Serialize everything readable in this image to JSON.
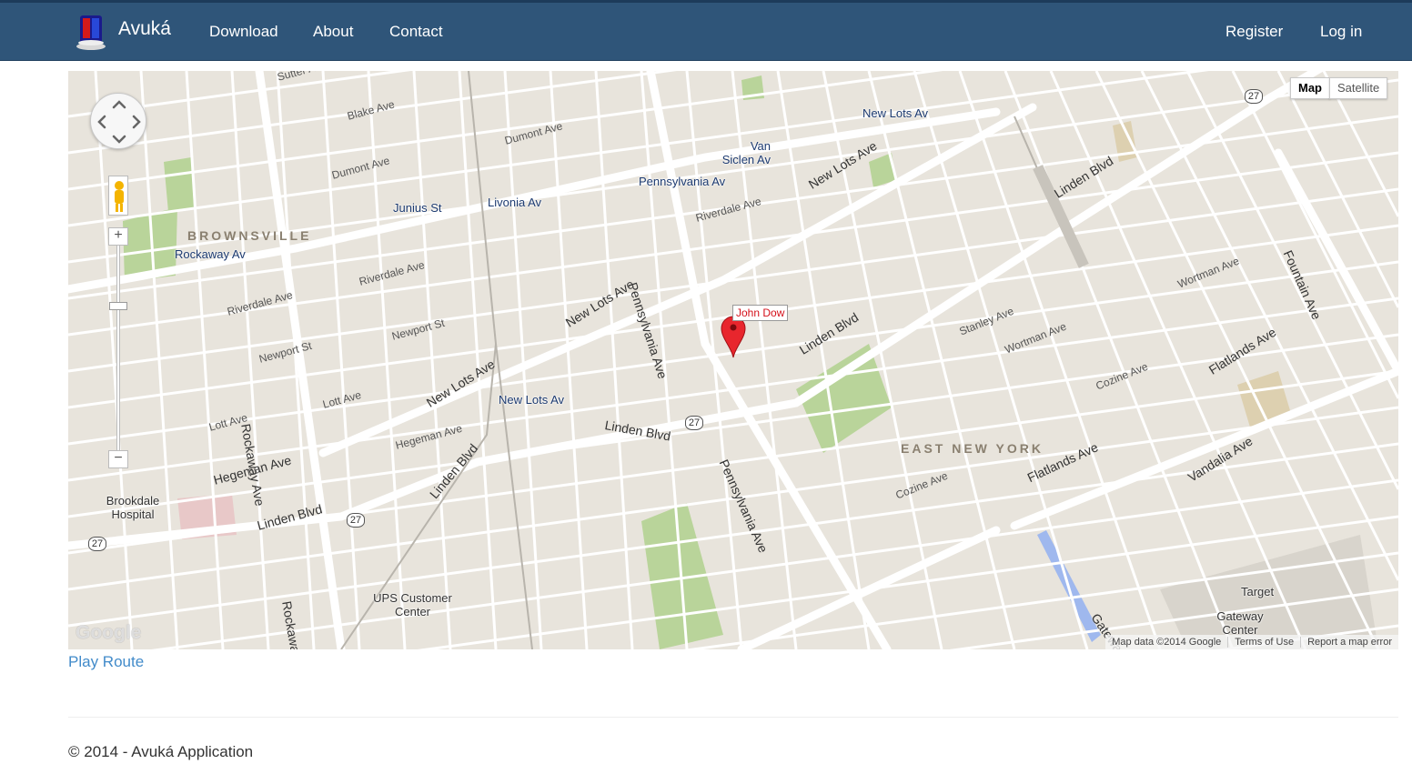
{
  "navbar": {
    "brand": "Avuká",
    "links": [
      "Download",
      "About",
      "Contact"
    ],
    "right_links": [
      "Register",
      "Log in"
    ]
  },
  "map": {
    "type_buttons": [
      "Map",
      "Satellite"
    ],
    "neighborhoods": [
      "BROWNSVILLE",
      "EAST NEW YORK"
    ],
    "stations": [
      "New Lots Av",
      "Van Siclen Av",
      "Pennsylvania Av",
      "Junius St",
      "Livonia Av",
      "Rockaway Av",
      "New Lots Av"
    ],
    "places": [
      "Brookdale Hospital",
      "UPS Customer Center",
      "Target",
      "Gateway Center"
    ],
    "marker_label": "John Dow",
    "zoom_in": "+",
    "zoom_out": "−",
    "google_logo": "Google",
    "attribution": [
      "Map data ©2014 Google",
      "Terms of Use",
      "Report a map error"
    ],
    "route_shield": "27"
  },
  "play_route": "Play Route",
  "footer": "© 2014 - Avuká Application",
  "colors": {
    "navbar": "#2f5579",
    "link": "#428bca",
    "map_bg": "#e8e4dc",
    "marker": "#d4101a"
  }
}
